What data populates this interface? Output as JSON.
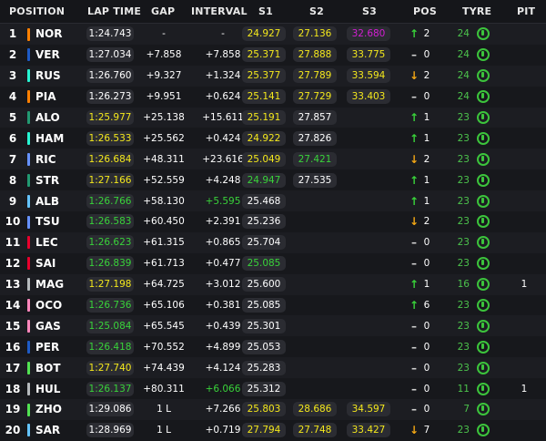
{
  "headers": {
    "position": "POSITION",
    "lap_time": "LAP TIME",
    "gap": "GAP",
    "interval": "INTERVAL",
    "s1": "S1",
    "s2": "S2",
    "s3": "S3",
    "pos": "POS",
    "tyre": "TYRE",
    "pit": "PIT"
  },
  "colors": {
    "yellow": "#f4e81c",
    "green": "#39d33a",
    "purple": "#d31fd3",
    "tyre_green": "#3cc43c",
    "pos_down": "#f2a614"
  },
  "rows": [
    {
      "pos": "1",
      "driver": "NOR",
      "team_color": "#ff8000",
      "lap": "1:24.743",
      "lap_c": "white",
      "gap": "-",
      "int": "-",
      "int_c": "white",
      "s1": "24.927",
      "s1_c": "yellow",
      "s2": "27.136",
      "s2_c": "yellow",
      "s3": "32.680",
      "s3_c": "purple",
      "dir": "up",
      "chg": "2",
      "age": "24",
      "pit": ""
    },
    {
      "pos": "2",
      "driver": "VER",
      "team_color": "#1e5bc6",
      "lap": "1:27.034",
      "lap_c": "white",
      "gap": "+7.858",
      "int": "+7.858",
      "int_c": "white",
      "s1": "25.371",
      "s1_c": "yellow",
      "s2": "27.888",
      "s2_c": "yellow",
      "s3": "33.775",
      "s3_c": "yellow",
      "dir": "flat",
      "chg": "0",
      "age": "24",
      "pit": ""
    },
    {
      "pos": "3",
      "driver": "RUS",
      "team_color": "#27f4d2",
      "lap": "1:26.760",
      "lap_c": "white",
      "gap": "+9.327",
      "int": "+1.324",
      "int_c": "white",
      "s1": "25.377",
      "s1_c": "yellow",
      "s2": "27.789",
      "s2_c": "yellow",
      "s3": "33.594",
      "s3_c": "yellow",
      "dir": "down",
      "chg": "2",
      "age": "24",
      "pit": ""
    },
    {
      "pos": "4",
      "driver": "PIA",
      "team_color": "#ff8000",
      "lap": "1:26.273",
      "lap_c": "white",
      "gap": "+9.951",
      "int": "+0.624",
      "int_c": "white",
      "s1": "25.141",
      "s1_c": "yellow",
      "s2": "27.729",
      "s2_c": "yellow",
      "s3": "33.403",
      "s3_c": "yellow",
      "dir": "flat",
      "chg": "0",
      "age": "24",
      "pit": ""
    },
    {
      "pos": "5",
      "driver": "ALO",
      "team_color": "#229971",
      "lap": "1:25.977",
      "lap_c": "yellow",
      "gap": "+25.138",
      "int": "+15.611",
      "int_c": "white",
      "s1": "25.191",
      "s1_c": "yellow",
      "s2": "27.857",
      "s2_c": "white",
      "s3": "",
      "s3_c": "white",
      "dir": "up",
      "chg": "1",
      "age": "23",
      "pit": ""
    },
    {
      "pos": "6",
      "driver": "HAM",
      "team_color": "#27f4d2",
      "lap": "1:26.533",
      "lap_c": "yellow",
      "gap": "+25.562",
      "int": "+0.424",
      "int_c": "white",
      "s1": "24.922",
      "s1_c": "yellow",
      "s2": "27.826",
      "s2_c": "white",
      "s3": "",
      "s3_c": "white",
      "dir": "up",
      "chg": "1",
      "age": "23",
      "pit": ""
    },
    {
      "pos": "7",
      "driver": "RIC",
      "team_color": "#6692ff",
      "lap": "1:26.684",
      "lap_c": "yellow",
      "gap": "+48.311",
      "int": "+23.616",
      "int_c": "white",
      "s1": "25.049",
      "s1_c": "yellow",
      "s2": "27.421",
      "s2_c": "green",
      "s3": "",
      "s3_c": "white",
      "dir": "down",
      "chg": "2",
      "age": "23",
      "pit": ""
    },
    {
      "pos": "8",
      "driver": "STR",
      "team_color": "#229971",
      "lap": "1:27.166",
      "lap_c": "yellow",
      "gap": "+52.559",
      "int": "+4.248",
      "int_c": "white",
      "s1": "24.947",
      "s1_c": "green",
      "s2": "27.535",
      "s2_c": "white",
      "s3": "",
      "s3_c": "white",
      "dir": "up",
      "chg": "1",
      "age": "23",
      "pit": ""
    },
    {
      "pos": "9",
      "driver": "ALB",
      "team_color": "#64c4ff",
      "lap": "1:26.766",
      "lap_c": "green",
      "gap": "+58.130",
      "int": "+5.595",
      "int_c": "green",
      "s1": "25.468",
      "s1_c": "white",
      "s2": "",
      "s2_c": "white",
      "s3": "",
      "s3_c": "white",
      "dir": "up",
      "chg": "1",
      "age": "23",
      "pit": ""
    },
    {
      "pos": "10",
      "driver": "TSU",
      "team_color": "#6692ff",
      "lap": "1:26.583",
      "lap_c": "green",
      "gap": "+60.450",
      "int": "+2.391",
      "int_c": "white",
      "s1": "25.236",
      "s1_c": "white",
      "s2": "",
      "s2_c": "white",
      "s3": "",
      "s3_c": "white",
      "dir": "down",
      "chg": "2",
      "age": "23",
      "pit": ""
    },
    {
      "pos": "11",
      "driver": "LEC",
      "team_color": "#e8002d",
      "lap": "1:26.623",
      "lap_c": "green",
      "gap": "+61.315",
      "int": "+0.865",
      "int_c": "white",
      "s1": "25.704",
      "s1_c": "white",
      "s2": "",
      "s2_c": "white",
      "s3": "",
      "s3_c": "white",
      "dir": "flat",
      "chg": "0",
      "age": "23",
      "pit": ""
    },
    {
      "pos": "12",
      "driver": "SAI",
      "team_color": "#e8002d",
      "lap": "1:26.839",
      "lap_c": "green",
      "gap": "+61.713",
      "int": "+0.477",
      "int_c": "white",
      "s1": "25.085",
      "s1_c": "green",
      "s2": "",
      "s2_c": "white",
      "s3": "",
      "s3_c": "white",
      "dir": "flat",
      "chg": "0",
      "age": "23",
      "pit": ""
    },
    {
      "pos": "13",
      "driver": "MAG",
      "team_color": "#b6babd",
      "lap": "1:27.198",
      "lap_c": "yellow",
      "gap": "+64.725",
      "int": "+3.012",
      "int_c": "white",
      "s1": "25.600",
      "s1_c": "white",
      "s2": "",
      "s2_c": "white",
      "s3": "",
      "s3_c": "white",
      "dir": "up",
      "chg": "1",
      "age": "16",
      "pit": "1"
    },
    {
      "pos": "14",
      "driver": "OCO",
      "team_color": "#ff87bc",
      "lap": "1:26.736",
      "lap_c": "green",
      "gap": "+65.106",
      "int": "+0.381",
      "int_c": "white",
      "s1": "25.085",
      "s1_c": "white",
      "s2": "",
      "s2_c": "white",
      "s3": "",
      "s3_c": "white",
      "dir": "up",
      "chg": "6",
      "age": "23",
      "pit": ""
    },
    {
      "pos": "15",
      "driver": "GAS",
      "team_color": "#ff87bc",
      "lap": "1:25.084",
      "lap_c": "green",
      "gap": "+65.545",
      "int": "+0.439",
      "int_c": "white",
      "s1": "25.301",
      "s1_c": "white",
      "s2": "",
      "s2_c": "white",
      "s3": "",
      "s3_c": "white",
      "dir": "flat",
      "chg": "0",
      "age": "23",
      "pit": ""
    },
    {
      "pos": "16",
      "driver": "PER",
      "team_color": "#1e5bc6",
      "lap": "1:26.418",
      "lap_c": "green",
      "gap": "+70.552",
      "int": "+4.899",
      "int_c": "white",
      "s1": "25.053",
      "s1_c": "white",
      "s2": "",
      "s2_c": "white",
      "s3": "",
      "s3_c": "white",
      "dir": "flat",
      "chg": "0",
      "age": "23",
      "pit": ""
    },
    {
      "pos": "17",
      "driver": "BOT",
      "team_color": "#52e252",
      "lap": "1:27.740",
      "lap_c": "yellow",
      "gap": "+74.439",
      "int": "+4.124",
      "int_c": "white",
      "s1": "25.283",
      "s1_c": "white",
      "s2": "",
      "s2_c": "white",
      "s3": "",
      "s3_c": "white",
      "dir": "flat",
      "chg": "0",
      "age": "23",
      "pit": ""
    },
    {
      "pos": "18",
      "driver": "HUL",
      "team_color": "#b6babd",
      "lap": "1:26.137",
      "lap_c": "green",
      "gap": "+80.311",
      "int": "+6.066",
      "int_c": "green",
      "s1": "25.312",
      "s1_c": "white",
      "s2": "",
      "s2_c": "white",
      "s3": "",
      "s3_c": "white",
      "dir": "flat",
      "chg": "0",
      "age": "11",
      "pit": "1"
    },
    {
      "pos": "19",
      "driver": "ZHO",
      "team_color": "#52e252",
      "lap": "1:29.086",
      "lap_c": "white",
      "gap": "1 L",
      "int": "+7.266",
      "int_c": "white",
      "s1": "25.803",
      "s1_c": "yellow",
      "s2": "28.686",
      "s2_c": "yellow",
      "s3": "34.597",
      "s3_c": "yellow",
      "dir": "flat",
      "chg": "0",
      "age": "7",
      "pit": ""
    },
    {
      "pos": "20",
      "driver": "SAR",
      "team_color": "#64c4ff",
      "lap": "1:28.969",
      "lap_c": "white",
      "gap": "1 L",
      "int": "+0.719",
      "int_c": "white",
      "s1": "27.794",
      "s1_c": "yellow",
      "s2": "27.748",
      "s2_c": "yellow",
      "s3": "33.427",
      "s3_c": "yellow",
      "dir": "down",
      "chg": "7",
      "age": "23",
      "pit": ""
    }
  ]
}
